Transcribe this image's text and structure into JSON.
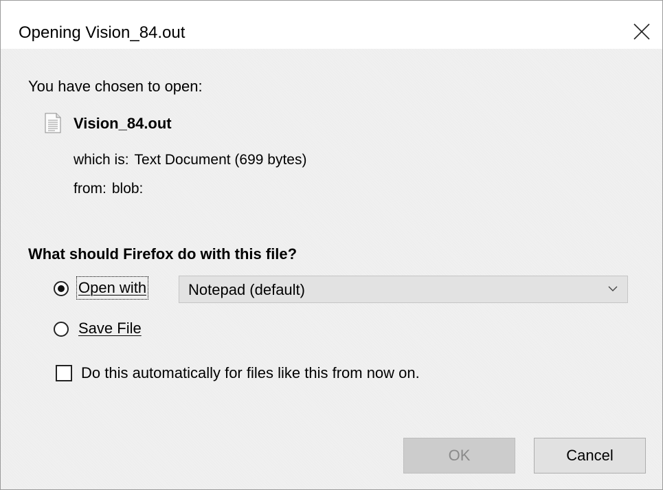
{
  "window": {
    "title": "Opening Vision_84.out",
    "close_icon": "close-icon"
  },
  "intro_text": "You have chosen to open:",
  "file": {
    "icon": "text-document-icon",
    "name": "Vision_84.out",
    "which_is_label": "which is:",
    "which_is_value": "Text Document (699 bytes)",
    "from_label": "from:",
    "from_value": "blob:"
  },
  "question": "What should Firefox do with this file?",
  "options": {
    "open_with_label": "Open with",
    "open_with_selected": true,
    "application": "Notepad (default)",
    "save_file_label": "Save File",
    "save_file_selected": false
  },
  "remember": {
    "label": "Do this automatically for files like this from now on.",
    "checked": false
  },
  "buttons": {
    "ok": "OK",
    "ok_enabled": false,
    "cancel": "Cancel"
  }
}
